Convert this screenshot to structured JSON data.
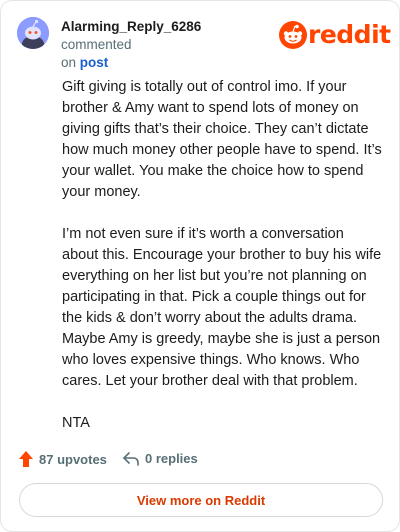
{
  "comment": {
    "author": "Alarming_Reply_6286",
    "action": "commented",
    "on_word": "on",
    "post_link": "post",
    "paragraphs": [
      "Gift giving is totally out of control imo. If your brother & Amy want to spend lots of money on giving gifts that’s their choice. They can’t dictate how much money other people have to spend. It’s your wallet. You make the choice how to spend your money.",
      "I’m not even sure if it’s worth a conversation about this. Encourage your brother to buy his wife everything on her list but you’re not planning on participating in that. Pick a couple things out for the kids & don’t worry about the adults drama. Maybe Amy is greedy, maybe she is just a person who loves expensive things. Who knows. Who cares. Let your brother deal with that problem.",
      "NTA"
    ]
  },
  "brand": {
    "logo_text": "reddit",
    "color": "#ff4500"
  },
  "stats": {
    "upvotes": "87 upvotes",
    "replies": "0 replies"
  },
  "icons": {
    "upvote": "upvote-arrow-icon",
    "reply": "reply-arrow-icon",
    "avatar": "snoo-avatar-icon",
    "logo": "reddit-snoo-icon"
  },
  "cta": {
    "view_more": "View more on Reddit",
    "color": "#d93a00"
  }
}
